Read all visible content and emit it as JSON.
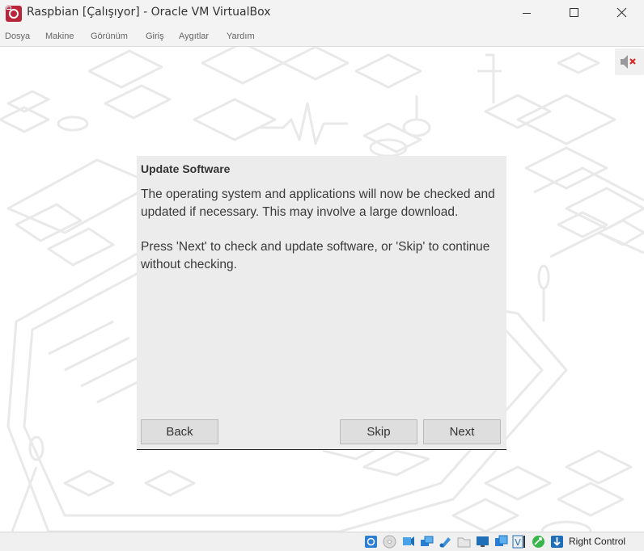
{
  "window": {
    "title": "Raspbian [Çalışıyor] - Oracle VM VirtualBox"
  },
  "menu": {
    "items": [
      "Dosya",
      "Makine",
      "Görünüm",
      "Giriş",
      "Aygıtlar",
      "Yardım"
    ]
  },
  "dialog": {
    "title": "Update Software",
    "paragraph1": "The operating system and applications will now be checked and updated if necessary. This may involve a large download.",
    "paragraph2": "Press 'Next' to check and update software, or 'Skip' to continue without checking.",
    "buttons": {
      "back": "Back",
      "skip": "Skip",
      "next": "Next"
    }
  },
  "statusbar": {
    "host_key": "Right Control",
    "icons": [
      "hard-disk-icon",
      "optical-drive-icon",
      "audio-icon",
      "network-icon",
      "usb-icon",
      "shared-folders-icon",
      "display-icon",
      "recording-icon",
      "virtualization-icon",
      "mouse-integration-icon",
      "host-key-arrow-icon"
    ]
  },
  "colors": {
    "accent": "#b9263b",
    "dialog_bg": "#ececec",
    "button_bg": "#dedede"
  }
}
